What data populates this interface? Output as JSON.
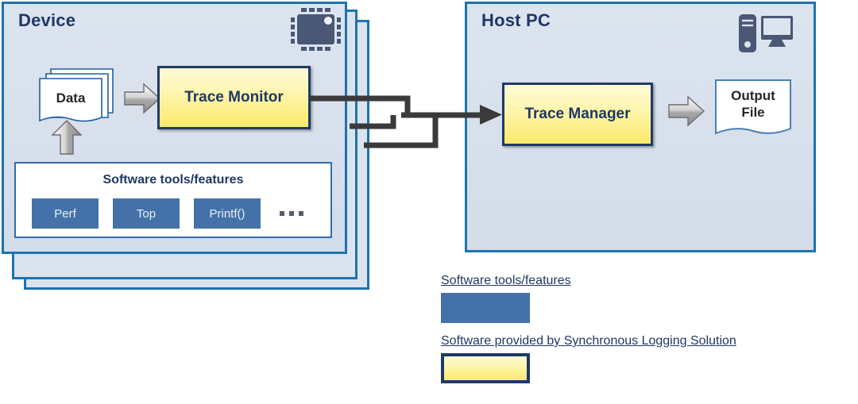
{
  "diagram": {
    "device_panel": {
      "title": "Device",
      "chip_icon": "chip-icon",
      "data_label": "Data",
      "trace_monitor_label": "Trace Monitor",
      "tools_card": {
        "title": "Software tools/features",
        "tools": [
          "Perf",
          "Top",
          "Printf()"
        ],
        "ellipsis": "..."
      },
      "stack_count": 3
    },
    "host_panel": {
      "title": "Host PC",
      "pc_icon": "desktop-computer-icon",
      "trace_manager_label": "Trace Manager",
      "output_file_label": "Output\nFile",
      "output_file_line1": "Output",
      "output_file_line2": "File"
    },
    "legend": {
      "items": [
        {
          "label": "Software tools/features",
          "swatch": "solid-blue",
          "color": "#4472a8"
        },
        {
          "label": "Software provided by Synchronous Logging Solution",
          "swatch": "yellow-bordered",
          "color": "#fdf5ab",
          "border_color": "#1f3a66"
        }
      ]
    },
    "colors": {
      "panel_border": "#1d74ad",
      "panel_fill": "#dce4ef",
      "title_text": "#1f3864",
      "tool_blue": "#4472a8",
      "yellow_fill": "#fdf5ab",
      "yellow_border": "#1f3a66",
      "connector": "#3a3a3a",
      "chip_body": "#4a5875"
    }
  }
}
